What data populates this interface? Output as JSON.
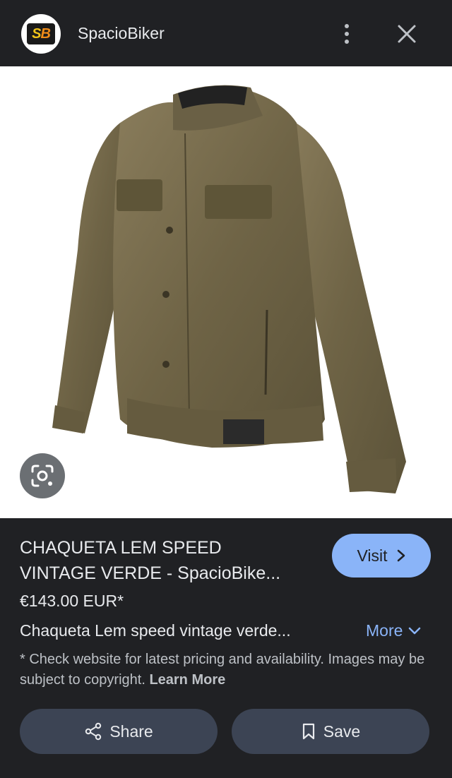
{
  "header": {
    "logo_text_s": "S",
    "logo_text_b": "B",
    "site_name": "SpacioBiker",
    "menu_icon": "more-vert-icon",
    "close_icon": "close-icon"
  },
  "image": {
    "subject": "jacket-image",
    "lens_icon": "lens-icon"
  },
  "product": {
    "title_line1": "CHAQUETA LEM SPEED",
    "title_line2": "VINTAGE VERDE - SpacioBike...",
    "price": "€143.00 EUR*",
    "description": "Chaqueta Lem speed vintage verde...",
    "more_label": "More",
    "disclaimer": "* Check website for latest pricing and availability. Images may be subject to copyright.",
    "learn_more_label": "Learn More"
  },
  "actions": {
    "visit_label": "Visit",
    "share_label": "Share",
    "save_label": "Save"
  },
  "colors": {
    "background": "#202124",
    "accent": "#8ab4f8",
    "button_bg": "#3c4454"
  }
}
